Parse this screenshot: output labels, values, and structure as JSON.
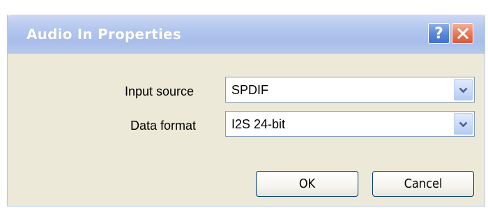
{
  "dialog": {
    "title": "Audio In Properties",
    "help_button": "?",
    "close_button": "close"
  },
  "fields": {
    "input_source": {
      "label": "Input source",
      "value": "SPDIF"
    },
    "data_format": {
      "label": "Data format",
      "value": "I2S 24-bit"
    }
  },
  "buttons": {
    "ok_label": "OK",
    "cancel_label": "Cancel"
  },
  "icons": {
    "help": "question-mark-icon",
    "close": "close-x-icon",
    "dropdown": "chevron-down-icon"
  },
  "colors": {
    "titlebar": "#b4c7ee",
    "dialog_bg": "#ece9d8",
    "close_button": "#e77a5a",
    "help_button": "#5d89d8"
  }
}
